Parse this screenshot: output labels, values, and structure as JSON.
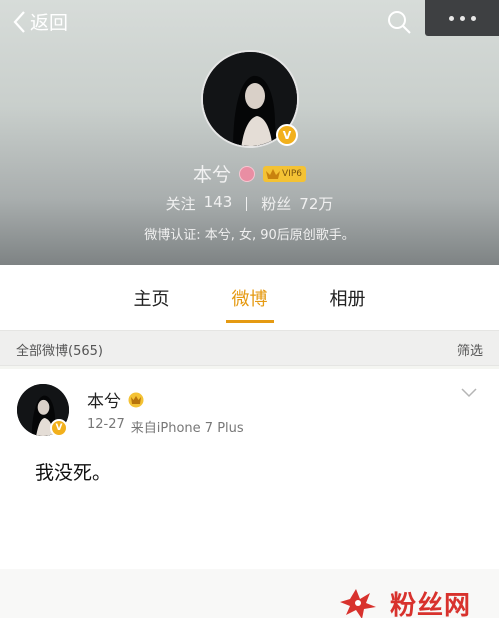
{
  "topbar": {
    "back_label": "返回"
  },
  "profile": {
    "name": "本兮",
    "vip_label": "VIP6",
    "verified_badge": "V",
    "following_label": "关注",
    "following_count": "143",
    "followers_label": "粉丝",
    "followers_count": "72万",
    "verification": "微博认证: 本兮, 女, 90后原创歌手。"
  },
  "tabs": [
    {
      "label": "主页",
      "active": false
    },
    {
      "label": "微博",
      "active": true
    },
    {
      "label": "相册",
      "active": false
    }
  ],
  "feed": {
    "title": "全部微博(565)",
    "filter_label": "筛选"
  },
  "post": {
    "author": "本兮",
    "date": "12-27",
    "source": "来自iPhone 7 Plus",
    "text": "我没死。",
    "verified_badge": "V"
  },
  "watermark": {
    "text": "粉丝网"
  },
  "colors": {
    "accent": "#e59a12",
    "vip_gold": "#f4c234",
    "verified": "#f2b01c",
    "watermark_red": "#d8322d"
  },
  "icons": {
    "back": "chevron-left-icon",
    "search": "search-icon",
    "more": "more-icon",
    "gender": "female-icon",
    "vip": "crown-icon",
    "post_menu": "chevron-down-icon",
    "watermark": "star-logo"
  }
}
